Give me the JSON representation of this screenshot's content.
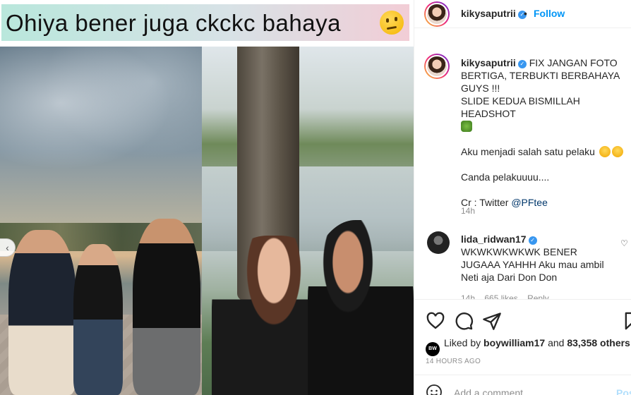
{
  "post_image": {
    "banner_text": "Ohiya bener juga ckckc bahaya",
    "banner_emoji": "thinking-face-emoji",
    "carousel_prev_icon": "chevron-left-icon"
  },
  "header": {
    "username": "kikysaputrii",
    "separator": "•",
    "follow_label": "Follow"
  },
  "caption": {
    "username": "kikysaputrii",
    "lines": [
      "FIX JANGAN FOTO BERTIGA, TERBUKTI BERBAHAYA GUYS !!!",
      "SLIDE KEDUA BISMILLAH HEADSHOT",
      "Aku menjadi salah satu pelaku",
      "Canda pelakuuuu....",
      "Cr : Twitter"
    ],
    "mention": "@PFtee",
    "time": "14h"
  },
  "comment": {
    "username": "lida_ridwan17",
    "text": "WKWKWKWKWK BENER JUGAAA YAHHH Aku mau ambil Neti aja Dari Don Don",
    "time": "14h",
    "likes": "665 likes",
    "reply": "Reply"
  },
  "likes": {
    "avatar_text": "BW",
    "prefix": "Liked by",
    "user": "boywilliam17",
    "middle": "and",
    "count": "83,358 others"
  },
  "post_time": "14 HOURS AGO",
  "add_comment": {
    "placeholder": "Add a comment...",
    "post_label": "Post"
  },
  "colors": {
    "follow": "#0095f6",
    "verified": "#3897f0",
    "muted": "#8e8e8e"
  }
}
